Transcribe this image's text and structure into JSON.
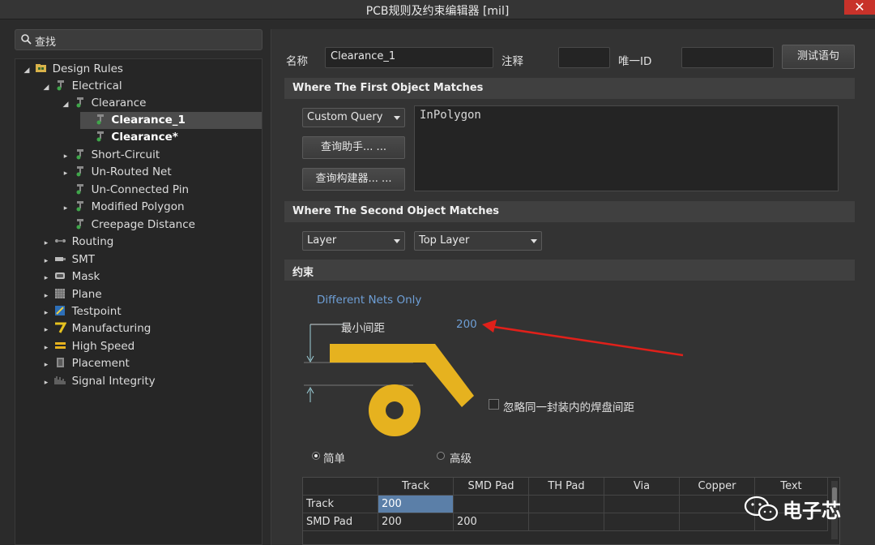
{
  "window": {
    "title": "PCB规则及约束编辑器 [mil]",
    "close": "✕"
  },
  "search": {
    "label": "查找"
  },
  "tree": [
    {
      "label": "Design Rules",
      "arrow": "◢",
      "indent": 0,
      "icon": "folder-icon"
    },
    {
      "label": "Electrical",
      "arrow": "◢",
      "indent": 1,
      "icon": "rule-icon"
    },
    {
      "label": "Clearance",
      "arrow": "◢",
      "indent": 2,
      "icon": "rule-icon"
    },
    {
      "label": "Clearance_1",
      "arrow": "",
      "indent": 3,
      "icon": "rule-icon",
      "selected": true,
      "bold": true
    },
    {
      "label": "Clearance*",
      "arrow": "",
      "indent": 3,
      "icon": "rule-icon",
      "bold": true
    },
    {
      "label": "Short-Circuit",
      "arrow": "▸",
      "indent": 2,
      "icon": "rule-icon"
    },
    {
      "label": "Un-Routed Net",
      "arrow": "▸",
      "indent": 2,
      "icon": "rule-icon"
    },
    {
      "label": "Un-Connected Pin",
      "arrow": "",
      "indent": 2,
      "icon": "rule-icon"
    },
    {
      "label": "Modified Polygon",
      "arrow": "▸",
      "indent": 2,
      "icon": "rule-icon"
    },
    {
      "label": "Creepage Distance",
      "arrow": "",
      "indent": 2,
      "icon": "rule-icon"
    },
    {
      "label": "Routing",
      "arrow": "▸",
      "indent": 1,
      "icon": "routing-icon"
    },
    {
      "label": "SMT",
      "arrow": "▸",
      "indent": 1,
      "icon": "smt-icon"
    },
    {
      "label": "Mask",
      "arrow": "▸",
      "indent": 1,
      "icon": "mask-icon"
    },
    {
      "label": "Plane",
      "arrow": "▸",
      "indent": 1,
      "icon": "plane-icon"
    },
    {
      "label": "Testpoint",
      "arrow": "▸",
      "indent": 1,
      "icon": "testpoint-icon"
    },
    {
      "label": "Manufacturing",
      "arrow": "▸",
      "indent": 1,
      "icon": "manufacturing-icon"
    },
    {
      "label": "High Speed",
      "arrow": "▸",
      "indent": 1,
      "icon": "high-speed-icon"
    },
    {
      "label": "Placement",
      "arrow": "▸",
      "indent": 1,
      "icon": "placement-icon"
    },
    {
      "label": "Signal Integrity",
      "arrow": "▸",
      "indent": 1,
      "icon": "signal-integrity-icon"
    }
  ],
  "header": {
    "name_label": "名称",
    "name_value": "Clearance_1",
    "comment_label": "注释",
    "comment_value": "",
    "uid_label": "唯一ID",
    "uid_value": "",
    "test_button": "测试语句"
  },
  "first_match": {
    "title": "Where The First Object Matches",
    "dropdown": "Custom Query",
    "helper_button": "查询助手... ...",
    "builder_button": "查询构建器... ...",
    "query": "InPolygon"
  },
  "second_match": {
    "title": "Where The Second Object Matches",
    "scope": "Layer",
    "layer": "Top Layer"
  },
  "constraints": {
    "title": "约束",
    "net_scope": "Different Nets Only",
    "min_clearance_label": "最小间距",
    "min_clearance_value": "200",
    "ignore_pads_label": "忽略同一封装内的焊盘间距",
    "mode_simple": "简单",
    "mode_advanced": "高级"
  },
  "table": {
    "columns": [
      "",
      "Track",
      "SMD Pad",
      "TH Pad",
      "Via",
      "Copper",
      "Text"
    ],
    "rows": [
      [
        "Track",
        "200",
        "",
        "",
        "",
        "",
        ""
      ],
      [
        "SMD Pad",
        "200",
        "200",
        "",
        "",
        "",
        ""
      ]
    ]
  },
  "watermark": {
    "text": "电子芯"
  },
  "colors": {
    "accent": "#6e9fd6",
    "copper": "#e6b21f",
    "arrow": "#e0201a",
    "selection": "#5b7fa8"
  }
}
